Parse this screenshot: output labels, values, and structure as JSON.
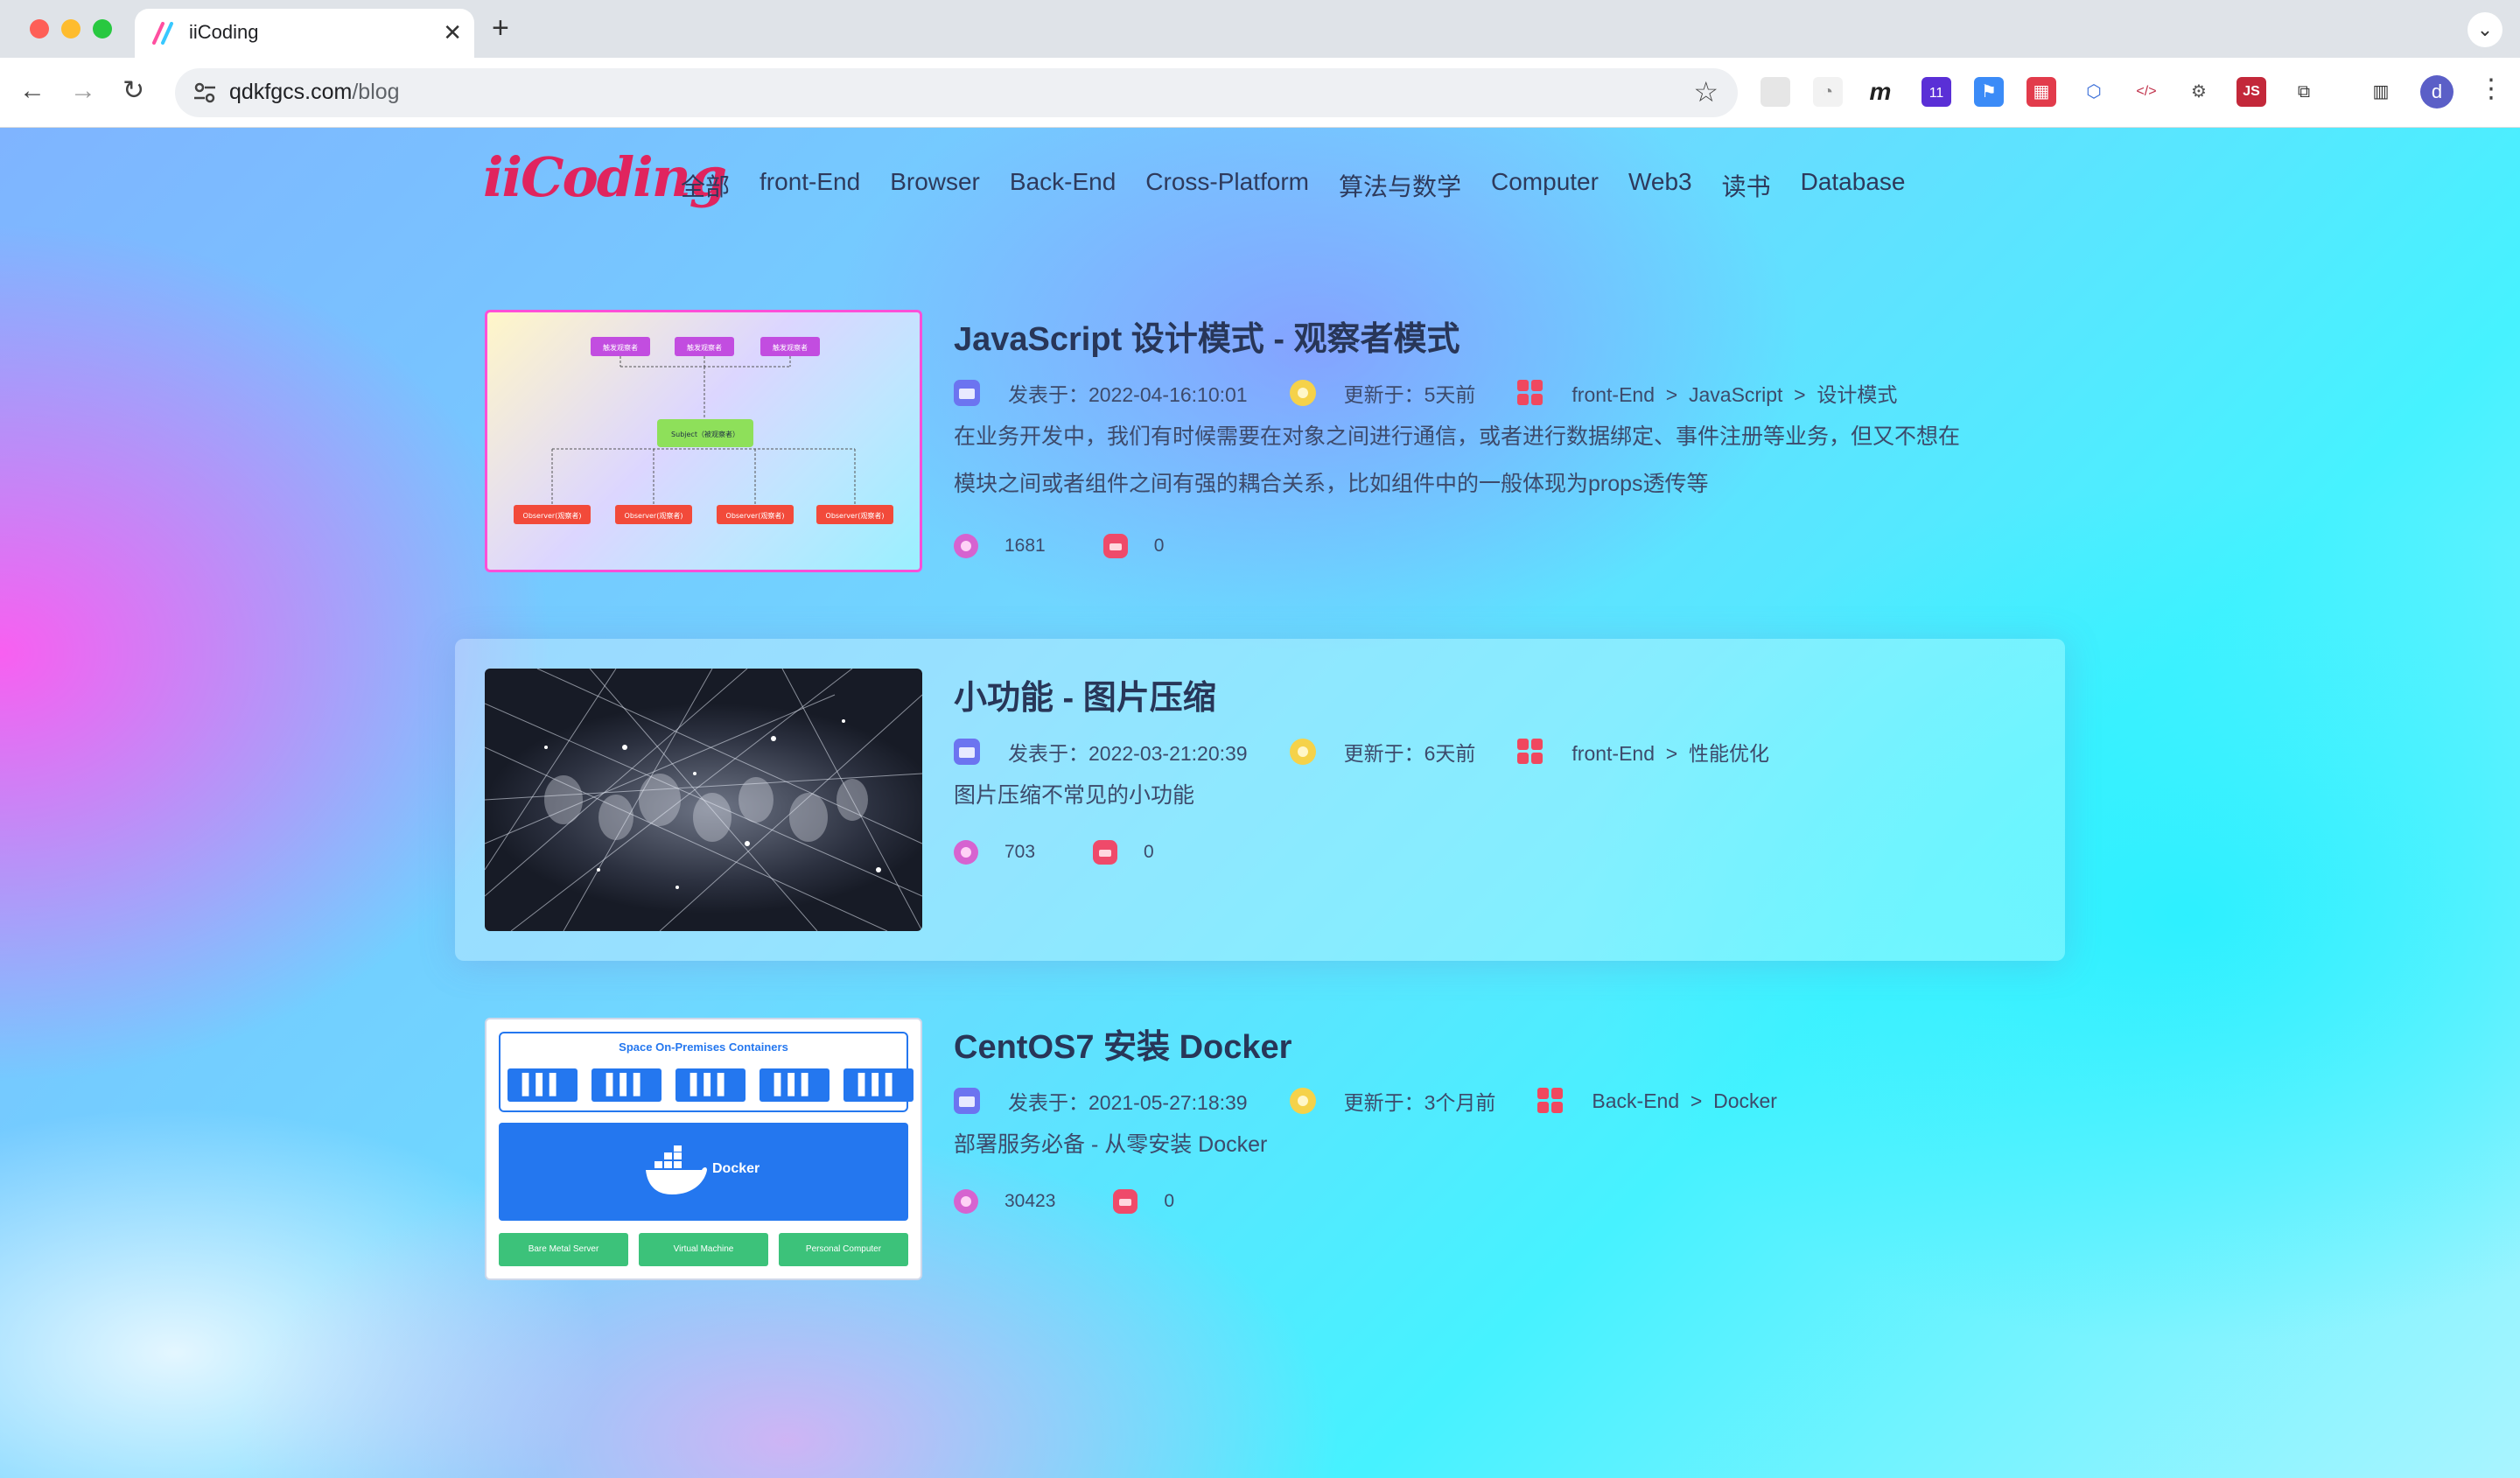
{
  "browser": {
    "tab_title": "iiCoding",
    "url_host": "qdkfgcs.com",
    "url_path": "/blog",
    "ext_badge": "11",
    "avatar_initial": "d"
  },
  "site": {
    "logo": "iiCoding",
    "nav": [
      "全部",
      "front-End",
      "Browser",
      "Back-End",
      "Cross-Platform",
      "算法与数学",
      "Computer",
      "Web3",
      "读书",
      "Database"
    ]
  },
  "posts": [
    {
      "title": "JavaScript 设计模式 - 观察者模式",
      "published": "发表于：2022-04-16:10:01",
      "updated": "更新于：5天前",
      "category": "front-End  >  JavaScript  >  设计模式",
      "desc_line1": "在业务开发中，我们有时候需要在对象之间进行通信，或者进行数据绑定、事件注册等业务，但又不想在",
      "desc_line2": "模块之间或者组件之间有强的耦合关系，比如组件中的一般体现为props透传等",
      "views": "1681",
      "comments": "0",
      "thumb": {
        "top_boxes": [
          "触发观察者",
          "触发观察者",
          "触发观察者"
        ],
        "subject": "Subject（被观察者）",
        "observers": [
          "Observer(观察者)",
          "Observer(观察者)",
          "Observer(观察者)",
          "Observer(观察者)"
        ]
      }
    },
    {
      "title": "小功能 - 图片压缩",
      "published": "发表于：2022-03-21:20:39",
      "updated": "更新于：6天前",
      "category": "front-End  >  性能优化",
      "desc_line1": "图片压缩不常见的小功能",
      "views": "703",
      "comments": "0"
    },
    {
      "title": "CentOS7 安装 Docker",
      "published": "发表于：2021-05-27:18:39",
      "updated": "更新于：3个月前",
      "category": "Back-End  >  Docker",
      "desc_line1": "部署服务必备 - 从零安装 Docker",
      "views": "30423",
      "comments": "0",
      "thumb": {
        "header": "Space On-Premises Containers",
        "engine": "Docker",
        "hosts": [
          "Bare Metal Server",
          "Virtual Machine",
          "Personal Computer"
        ]
      }
    }
  ],
  "colors": {
    "logo": "#e0245e",
    "docker_blue": "#2477ef",
    "host_green": "#3cc27a"
  }
}
